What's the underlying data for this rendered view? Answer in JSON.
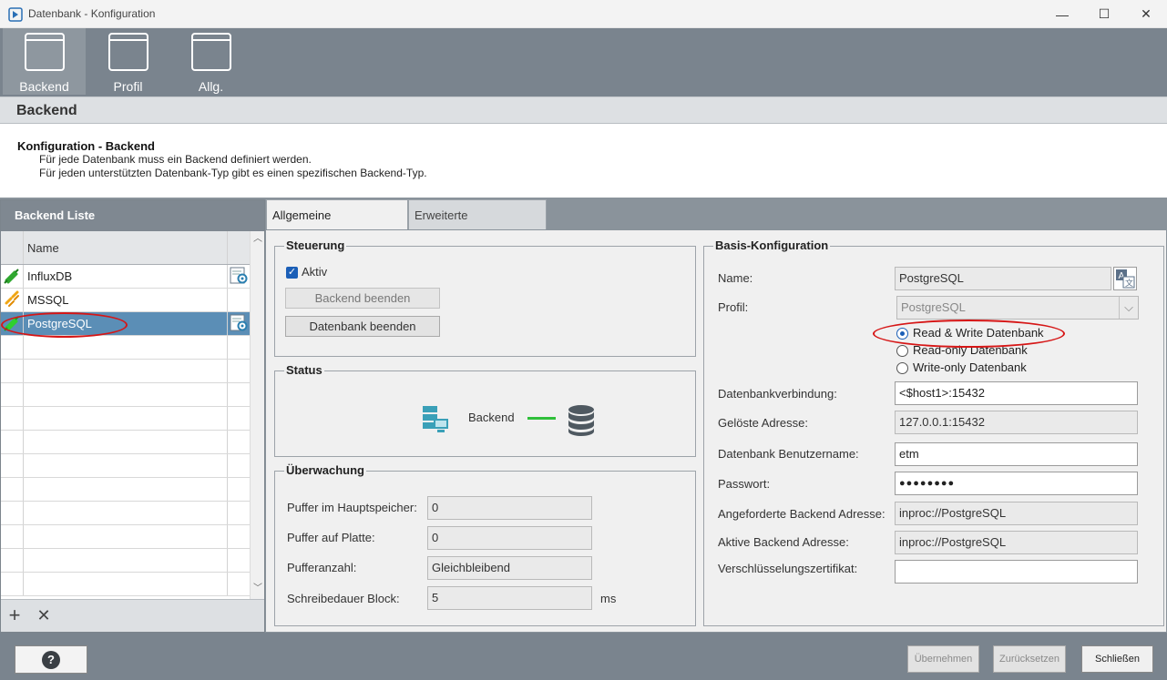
{
  "window": {
    "title": "Datenbank - Konfiguration",
    "minimize": "—",
    "maximize": "☐",
    "close": "✕"
  },
  "toolbar": {
    "items": [
      {
        "label": "Backend"
      },
      {
        "label": "Profil"
      },
      {
        "label": "Allg."
      }
    ]
  },
  "section": {
    "title": "Backend"
  },
  "description": {
    "title": "Konfiguration - Backend",
    "line1": "Für jede Datenbank muss ein Backend definiert werden.",
    "line2": "Für jeden unterstützten Datenbank-Typ gibt es einen spezifischen Backend-Typ."
  },
  "backend_list": {
    "title": "Backend Liste",
    "column_name": "Name",
    "rows": [
      {
        "name": "InfluxDB",
        "status": "connected"
      },
      {
        "name": "MSSQL",
        "status": "warning"
      },
      {
        "name": "PostgreSQL",
        "status": "connected",
        "selected": true
      }
    ],
    "add": "+",
    "remove": "✕"
  },
  "tabs": [
    {
      "label": "Allgemeine Einstellungen"
    },
    {
      "label": "Erweiterte Einstellungen"
    }
  ],
  "steuerung": {
    "title": "Steuerung",
    "aktiv_label": "Aktiv",
    "aktiv_checked": true,
    "stop_backend": "Backend beenden",
    "stop_db": "Datenbank beenden"
  },
  "status": {
    "title": "Status",
    "label": "Backend"
  },
  "ueberwachung": {
    "title": "Überwachung",
    "puffer_mem_label": "Puffer im Hauptspeicher:",
    "puffer_mem_value": "0",
    "puffer_disk_label": "Puffer auf Platte:",
    "puffer_disk_value": "0",
    "puffer_count_label": "Pufferanzahl:",
    "puffer_count_value": "Gleichbleibend",
    "write_label": "Schreibedauer Block:",
    "write_value": "5",
    "write_unit": "ms"
  },
  "basis": {
    "title": "Basis-Konfiguration",
    "name_label": "Name:",
    "name_value": "PostgreSQL",
    "profil_label": "Profil:",
    "profil_value": "PostgreSQL",
    "mode_rw": "Read & Write Datenbank",
    "mode_ro": "Read-only Datenbank",
    "mode_wo": "Write-only Datenbank",
    "conn_label": "Datenbankverbindung:",
    "conn_value": "<$host1>:15432",
    "resolved_label": "Gelöste Adresse:",
    "resolved_value": "127.0.0.1:15432",
    "user_label": "Datenbank Benutzername:",
    "user_value": "etm",
    "pass_label": "Passwort:",
    "pass_value": "●●●●●●●●",
    "req_label": "Angeforderte Backend Adresse:",
    "req_value": "inproc://PostgreSQL",
    "active_label": "Aktive Backend Adresse:",
    "active_value": "inproc://PostgreSQL",
    "cert_label": "Verschlüsselungszertifikat:",
    "cert_value": ""
  },
  "footer": {
    "help": "?",
    "apply": "Übernehmen",
    "reset": "Zurücksetzen",
    "close": "Schließen"
  },
  "colors": {
    "toolbar": "#7a848e",
    "selection": "#5b8eb6",
    "annotation": "#d61616",
    "status_line": "#2fbf3a"
  }
}
